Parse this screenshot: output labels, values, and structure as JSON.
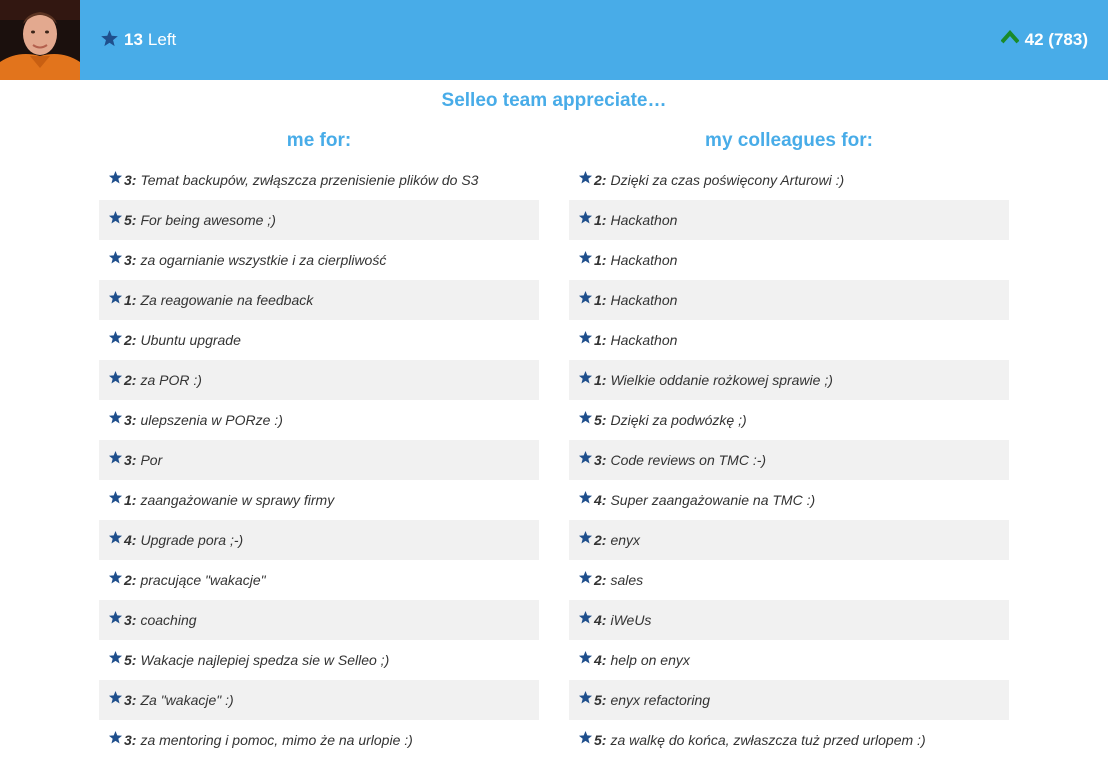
{
  "header": {
    "stars_left_count": "13",
    "stars_left_label": "Left",
    "score": "42 (783)",
    "colors": {
      "bar": "#48ace8",
      "star": "#1f4f8c",
      "up_arrow": "#1a8a2a"
    }
  },
  "headline": "Selleo team appreciate…",
  "columns": {
    "me": {
      "title": "me for:",
      "items": [
        {
          "points": "3",
          "text": "Temat backupów, zwłąszcza przenisienie plików do S3"
        },
        {
          "points": "5",
          "text": "For being awesome ;)"
        },
        {
          "points": "3",
          "text": "za ogarnianie wszystkie i za cierpliwość"
        },
        {
          "points": "1",
          "text": "Za reagowanie na feedback"
        },
        {
          "points": "2",
          "text": "Ubuntu upgrade"
        },
        {
          "points": "2",
          "text": "za POR :)"
        },
        {
          "points": "3",
          "text": "ulepszenia w PORze :)"
        },
        {
          "points": "3",
          "text": "Por"
        },
        {
          "points": "1",
          "text": "zaangażowanie w sprawy firmy"
        },
        {
          "points": "4",
          "text": "Upgrade pora ;-)"
        },
        {
          "points": "2",
          "text": "pracujące \"wakacje\""
        },
        {
          "points": "3",
          "text": "coaching"
        },
        {
          "points": "5",
          "text": "Wakacje najlepiej spedza sie w Selleo ;)"
        },
        {
          "points": "3",
          "text": "Za \"wakacje\" :)"
        },
        {
          "points": "3",
          "text": "za mentoring i pomoc, mimo że na urlopie :)"
        }
      ]
    },
    "colleagues": {
      "title": "my colleagues for:",
      "items": [
        {
          "points": "2",
          "text": "Dzięki za czas poświęcony Arturowi :)"
        },
        {
          "points": "1",
          "text": "Hackathon"
        },
        {
          "points": "1",
          "text": "Hackathon"
        },
        {
          "points": "1",
          "text": "Hackathon"
        },
        {
          "points": "1",
          "text": "Hackathon"
        },
        {
          "points": "1",
          "text": "Wielkie oddanie rożkowej sprawie ;)"
        },
        {
          "points": "5",
          "text": "Dzięki za podwózkę ;)"
        },
        {
          "points": "3",
          "text": "Code reviews on TMC :-)"
        },
        {
          "points": "4",
          "text": "Super zaangażowanie na TMC :)"
        },
        {
          "points": "2",
          "text": "enyx"
        },
        {
          "points": "2",
          "text": "sales"
        },
        {
          "points": "4",
          "text": "iWeUs"
        },
        {
          "points": "4",
          "text": "help on enyx"
        },
        {
          "points": "5",
          "text": "enyx refactoring"
        },
        {
          "points": "5",
          "text": "za walkę do końca, zwłaszcza tuż przed urlopem :)"
        }
      ]
    }
  }
}
